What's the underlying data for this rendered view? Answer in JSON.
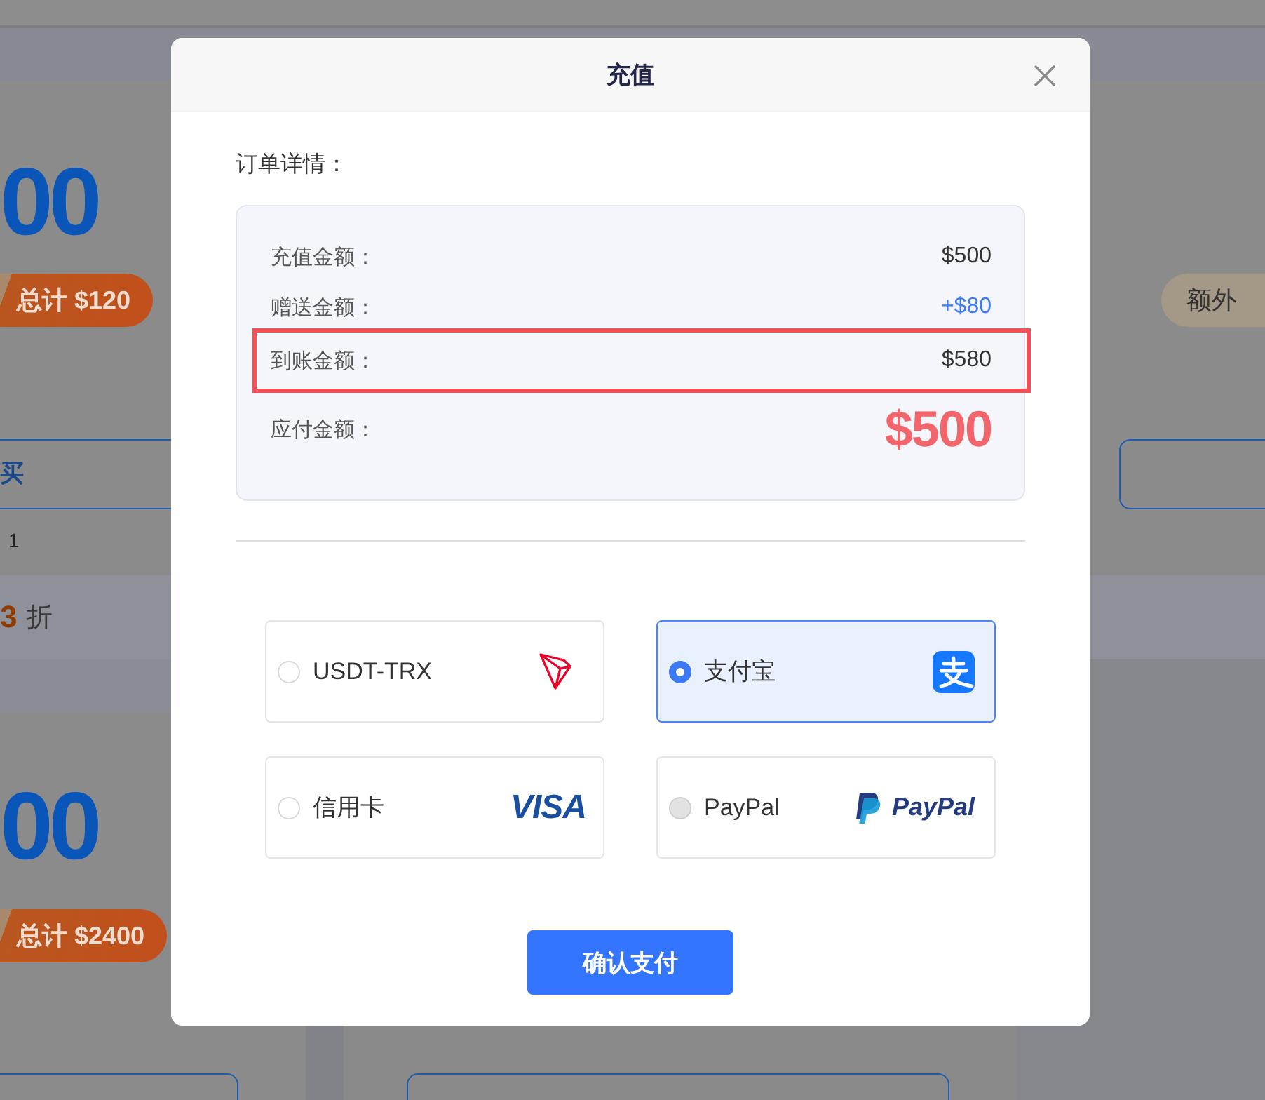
{
  "page_behind": {
    "top_left_card": {
      "amount": "00",
      "total_tag": "总计 $120",
      "button": "买",
      "note": "1"
    },
    "top_right_card": {
      "bonus_tag": "额外"
    },
    "discount_band": {
      "number": "3",
      "unit": "折"
    },
    "bottom_left_card": {
      "amount": "00",
      "total_tag": "总计 $2400"
    }
  },
  "dialog": {
    "title": "充值",
    "section_title": "订单详情：",
    "details": [
      {
        "label": "充值金额：",
        "value": "$500",
        "kind": "plain",
        "highlighted": false
      },
      {
        "label": "赠送金额：",
        "value": "+$80",
        "kind": "bonus",
        "highlighted": false
      },
      {
        "label": "到账金额：",
        "value": "$580",
        "kind": "plain",
        "highlighted": true
      },
      {
        "label": "应付金额：",
        "value": "$500",
        "kind": "due",
        "highlighted": false
      }
    ],
    "payment_methods": [
      {
        "label": "USDT-TRX",
        "kind": "tron",
        "selected": false,
        "disabled": false
      },
      {
        "label": "支付宝",
        "kind": "alipay",
        "selected": true,
        "disabled": false
      },
      {
        "label": "信用卡",
        "kind": "visa",
        "logo_text": "VISA",
        "selected": false,
        "disabled": false
      },
      {
        "label": "PayPal",
        "kind": "paypal",
        "logo_text": "PayPal",
        "selected": false,
        "disabled": true
      }
    ],
    "confirm_button": "确认支付"
  }
}
